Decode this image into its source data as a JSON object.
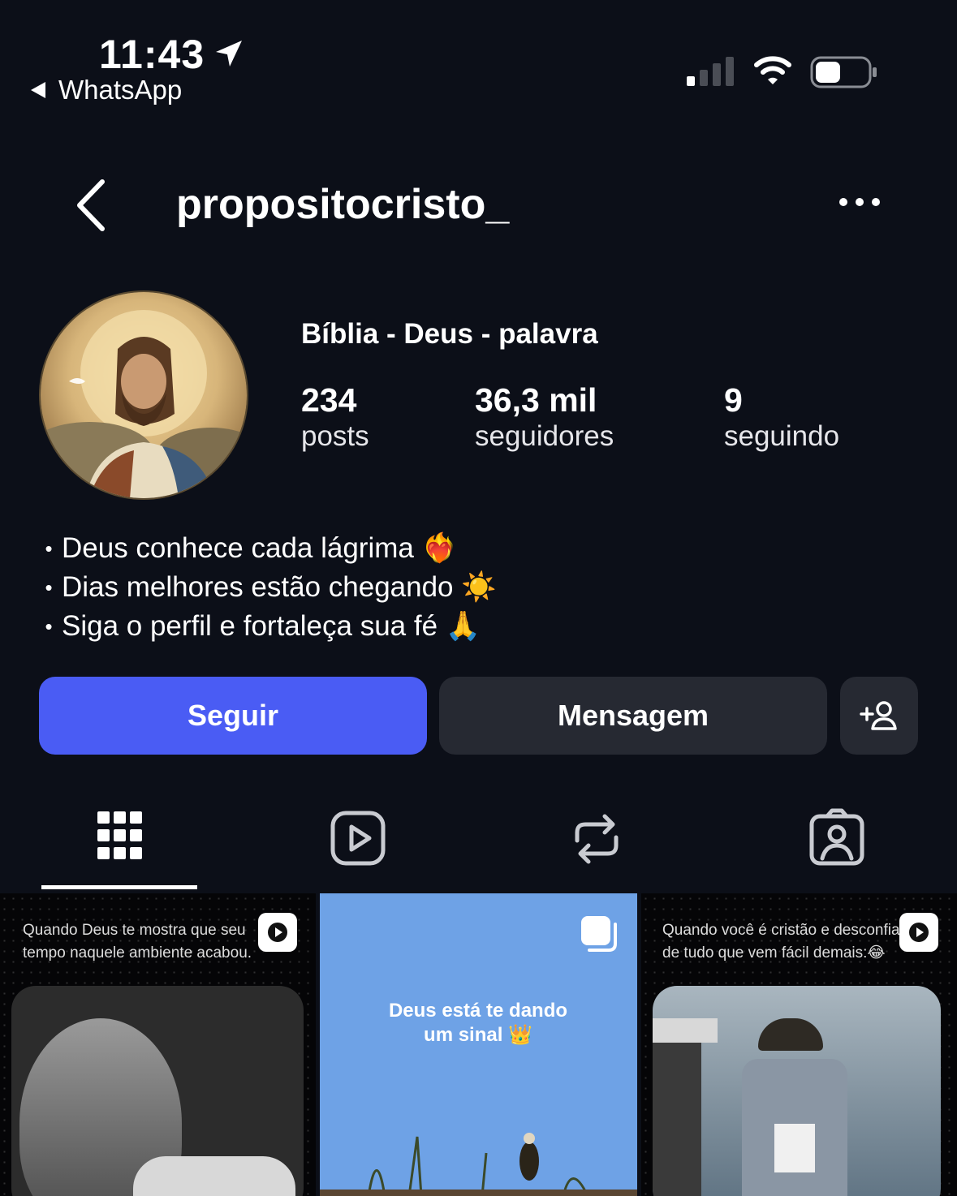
{
  "status_bar": {
    "time": "11:43",
    "back_app": "WhatsApp"
  },
  "header": {
    "username": "propositocristo_"
  },
  "profile": {
    "name": "Bíblia - Deus - palavra",
    "stats": [
      {
        "value": "234",
        "label": "posts"
      },
      {
        "value": "36,3 mil",
        "label": "seguidores"
      },
      {
        "value": "9",
        "label": "seguindo"
      }
    ],
    "bio": [
      "Deus conhece cada lágrima ❤️‍🔥",
      "Dias melhores estão chegando ☀️",
      "Siga o perfil e fortaleça sua fé 🙏"
    ]
  },
  "actions": {
    "follow": "Seguir",
    "message": "Mensagem"
  },
  "tabs": [
    "grid-icon",
    "reels-icon",
    "reposts-icon",
    "tagged-icon"
  ],
  "posts": [
    {
      "caption": "Quando Deus te mostra que seu tempo naquele ambiente acabou.",
      "badge": "reel-icon"
    },
    {
      "caption": "Deus está te dando um sinal 👑",
      "badge": "carousel-icon"
    },
    {
      "caption": "Quando você é cristão e desconfia de tudo que vem fácil demais:😂",
      "badge": "reel-icon"
    }
  ],
  "colors": {
    "background": "#0c0f18",
    "follow_button": "#4a5cf4",
    "secondary_button": "#262932"
  }
}
